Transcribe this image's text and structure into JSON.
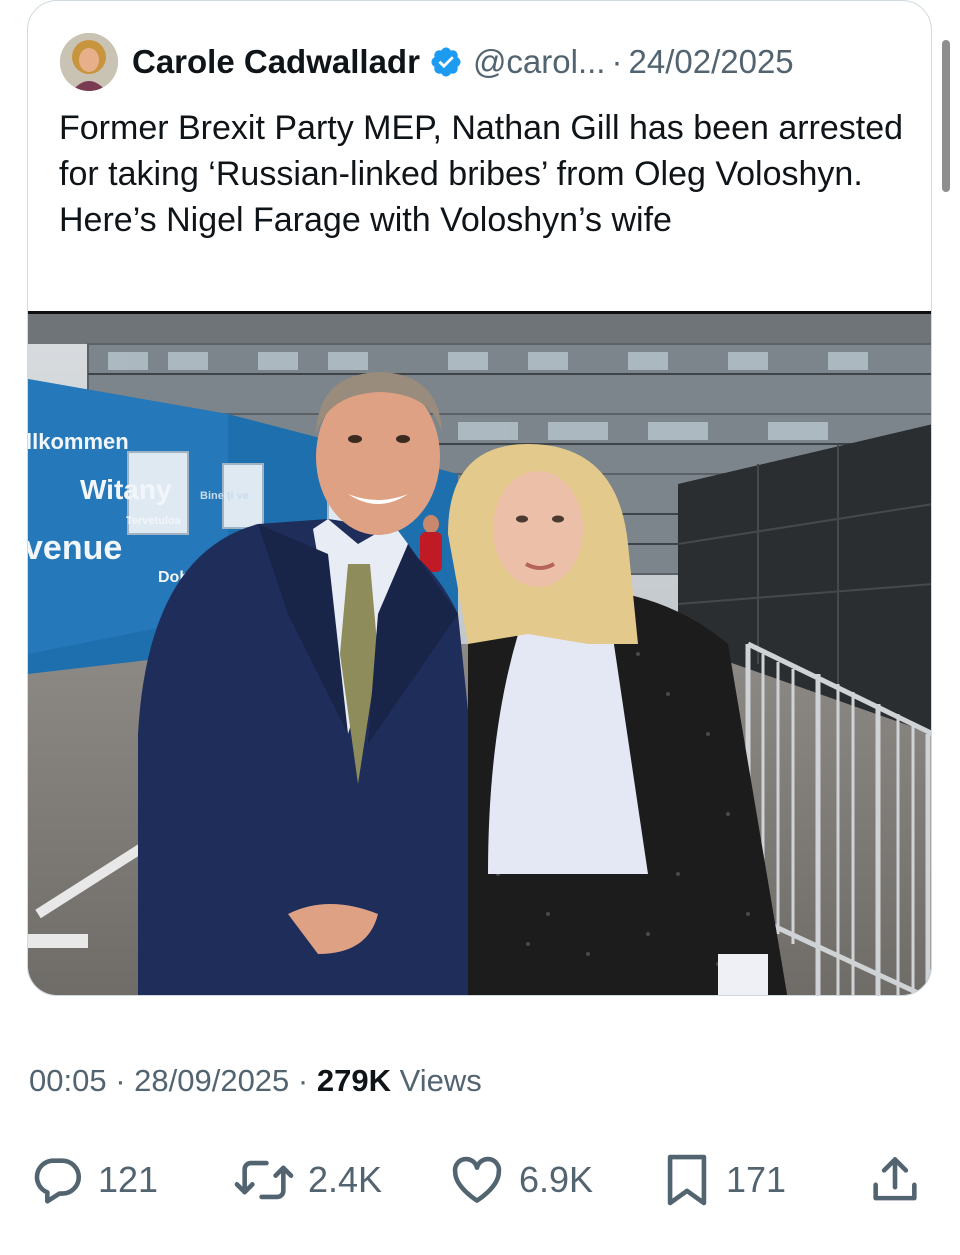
{
  "quoted_tweet": {
    "author_name": "Carole Cadwalladr",
    "handle": "@carol...",
    "date": "24/02/2025",
    "text": "Former Brexit Party MEP, Nathan Gill has been arrested for taking ‘Russian-linked bribes’ from Oleg Voloshyn. Here’s Nigel Farage with Voloshyn’s wife"
  },
  "photo_signage": {
    "line1": "llkommen",
    "line2": "Witany",
    "line3": "venue",
    "line4": "Tervetuloa",
    "line5": "Dobro",
    "line6": "Bine ți ve"
  },
  "tweet_meta": {
    "time": "00:05",
    "date": "28/09/2025",
    "views_count": "279K",
    "views_label": "Views"
  },
  "actions": {
    "replies": "121",
    "reposts": "2.4K",
    "likes": "6.9K",
    "bookmarks": "171"
  },
  "icons": {
    "reply": "reply-icon",
    "repost": "repost-icon",
    "like": "heart-icon",
    "bookmark": "bookmark-icon",
    "share": "share-icon",
    "verified": "verified-badge-icon"
  },
  "colors": {
    "verified_blue": "#1d9bf0",
    "secondary_text": "#536471",
    "primary_text": "#0f1419",
    "card_border": "#cfd9de"
  }
}
